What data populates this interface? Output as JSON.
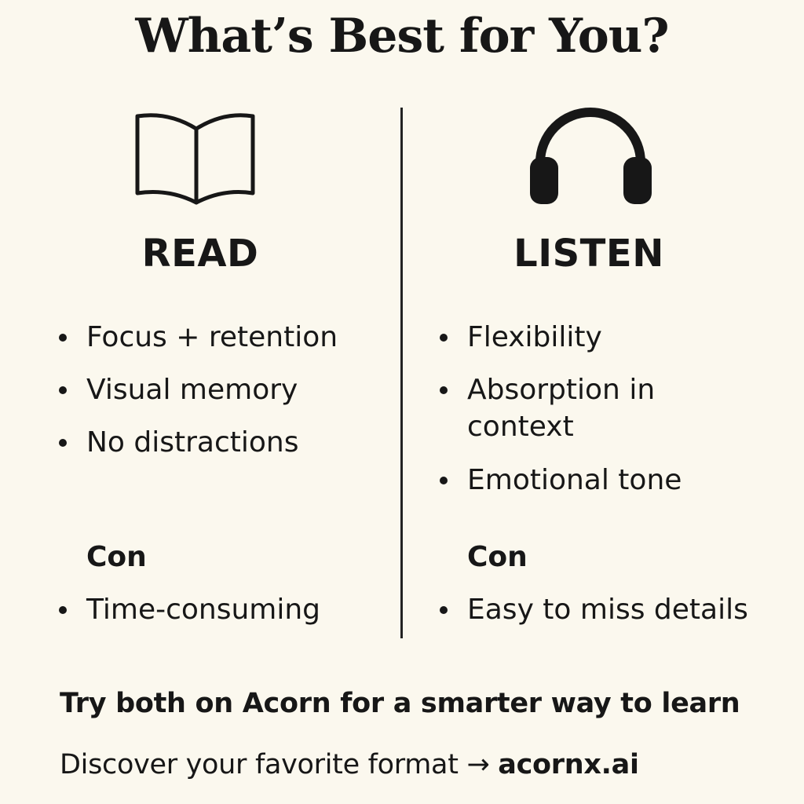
{
  "title": "What’s Best for You?",
  "read": {
    "icon": "open-book-icon",
    "heading": "READ",
    "pros": [
      "Focus + retention",
      "Visual memory",
      "No distractions"
    ],
    "con_label": "Con",
    "cons": [
      "Time-consuming"
    ]
  },
  "listen": {
    "icon": "headphones-icon",
    "heading": "LISTEN",
    "pros": [
      "Flexibility",
      "Absorption in",
      "context",
      "Emotional tone"
    ],
    "con_label": "Con",
    "cons": [
      "Easy to miss details"
    ]
  },
  "footer": {
    "cta": "Try both on Acorn for a smarter way to learn",
    "discover_text": "Discover your favorite format → ",
    "link": "acornx.ai"
  }
}
